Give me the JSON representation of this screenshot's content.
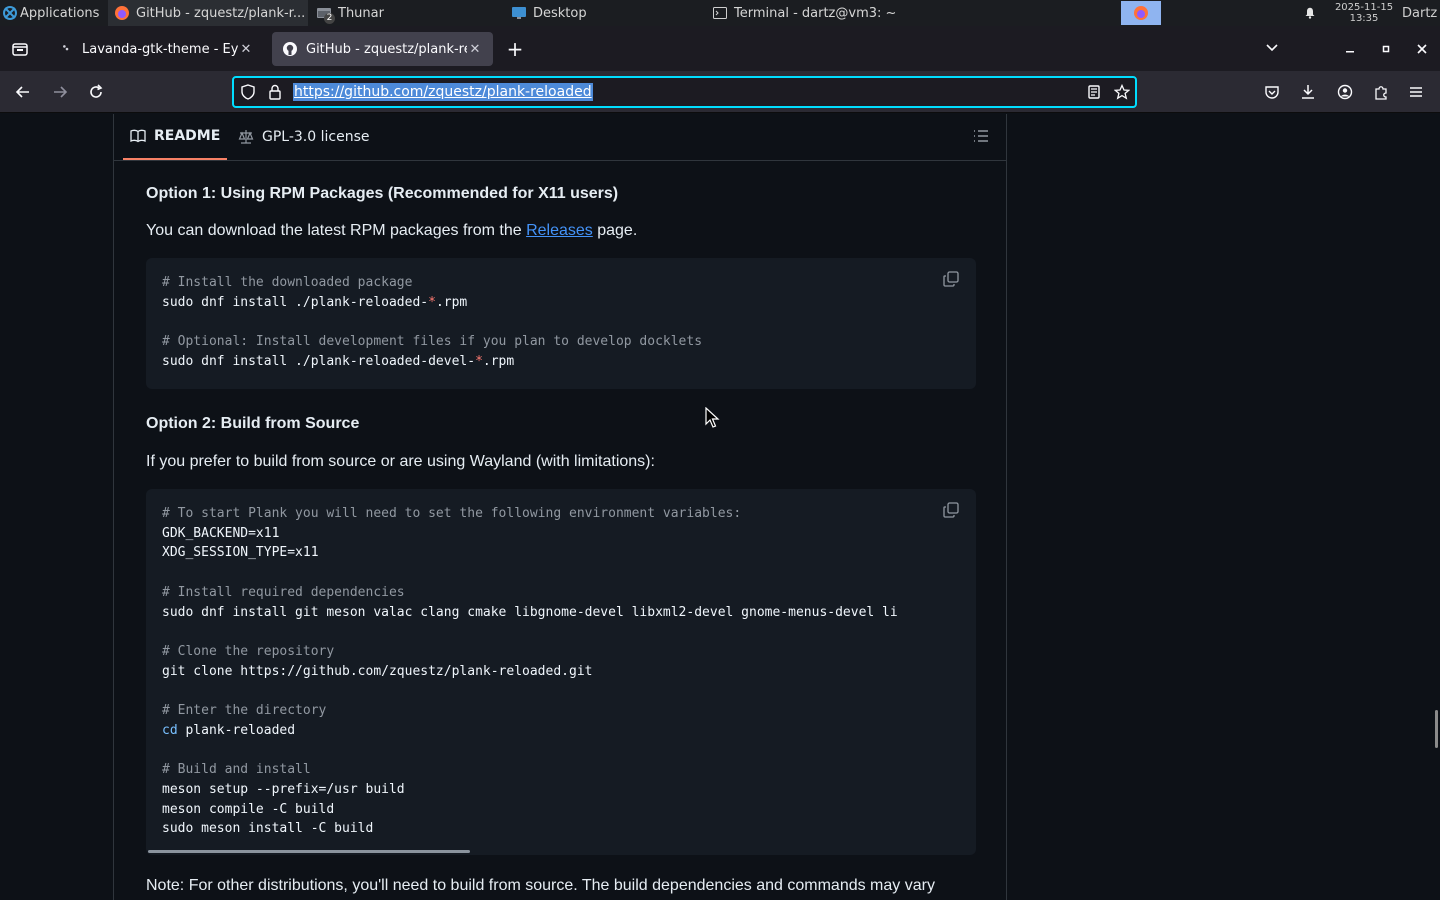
{
  "panel": {
    "apps_label": "Applications",
    "github_task": "GitHub - zquestz/plank-r...",
    "thunar_task": "Thunar",
    "thunar_badge": "2",
    "desktop_task": "Desktop",
    "terminal_task": "Terminal - dartz@vm3: ~",
    "clock_date": "2025-11-15",
    "clock_time": "13:35",
    "user": "Dartz"
  },
  "browser": {
    "tabs": [
      {
        "title": "Lavanda-gtk-theme - Eye",
        "active": false
      },
      {
        "title": "GitHub - zquestz/plank-reloaded",
        "active": true
      }
    ],
    "url": "https://github.com/zquestz/plank-reloaded"
  },
  "readme": {
    "tabs": [
      {
        "label": "README",
        "active": true
      },
      {
        "label": "GPL-3.0 license",
        "active": false
      }
    ],
    "option1_heading": "Option 1: Using RPM Packages (Recommended for X11 users)",
    "option1_text_before": "You can download the latest RPM packages from the ",
    "option1_link": "Releases",
    "option1_text_after": " page.",
    "code1": [
      {
        "parts": [
          {
            "t": "# Install the downloaded package",
            "c": "cmt"
          }
        ]
      },
      {
        "parts": [
          {
            "t": "sudo dnf install ./plank-reloaded-",
            "c": "txt"
          },
          {
            "t": "*",
            "c": "op"
          },
          {
            "t": ".rpm",
            "c": "txt"
          }
        ]
      },
      {
        "parts": []
      },
      {
        "parts": [
          {
            "t": "# Optional: Install development files if you plan to develop docklets",
            "c": "cmt"
          }
        ]
      },
      {
        "parts": [
          {
            "t": "sudo dnf install ./plank-reloaded-devel-",
            "c": "txt"
          },
          {
            "t": "*",
            "c": "op"
          },
          {
            "t": ".rpm",
            "c": "txt"
          }
        ]
      }
    ],
    "option2_heading": "Option 2: Build from Source",
    "option2_text": "If you prefer to build from source or are using Wayland (with limitations):",
    "code2": [
      {
        "parts": [
          {
            "t": "# To start Plank you will need to set the following environment variables:",
            "c": "cmt"
          }
        ]
      },
      {
        "parts": [
          {
            "t": "GDK_BACKEND=x11",
            "c": "txt"
          }
        ]
      },
      {
        "parts": [
          {
            "t": "XDG_SESSION_TYPE=x11",
            "c": "txt"
          }
        ]
      },
      {
        "parts": []
      },
      {
        "parts": [
          {
            "t": "# Install required dependencies",
            "c": "cmt"
          }
        ]
      },
      {
        "parts": [
          {
            "t": "sudo dnf install git meson valac clang cmake libgnome-devel libxml2-devel gnome-menus-devel li",
            "c": "txt"
          }
        ]
      },
      {
        "parts": []
      },
      {
        "parts": [
          {
            "t": "# Clone the repository",
            "c": "cmt"
          }
        ]
      },
      {
        "parts": [
          {
            "t": "git clone https://github.com/zquestz/plank-reloaded.git",
            "c": "txt"
          }
        ]
      },
      {
        "parts": []
      },
      {
        "parts": [
          {
            "t": "# Enter the directory",
            "c": "cmt"
          }
        ]
      },
      {
        "parts": [
          {
            "t": "cd",
            "c": "kw"
          },
          {
            "t": " plank-reloaded",
            "c": "txt"
          }
        ]
      },
      {
        "parts": []
      },
      {
        "parts": [
          {
            "t": "# Build and install",
            "c": "cmt"
          }
        ]
      },
      {
        "parts": [
          {
            "t": "meson setup --prefix=/usr build",
            "c": "txt"
          }
        ]
      },
      {
        "parts": [
          {
            "t": "meson compile -C build",
            "c": "txt"
          }
        ]
      },
      {
        "parts": [
          {
            "t": "sudo meson install -C build",
            "c": "txt"
          }
        ]
      }
    ],
    "note_text": "Note: For other distributions, you'll need to build from source. The build dependencies and commands may vary"
  }
}
